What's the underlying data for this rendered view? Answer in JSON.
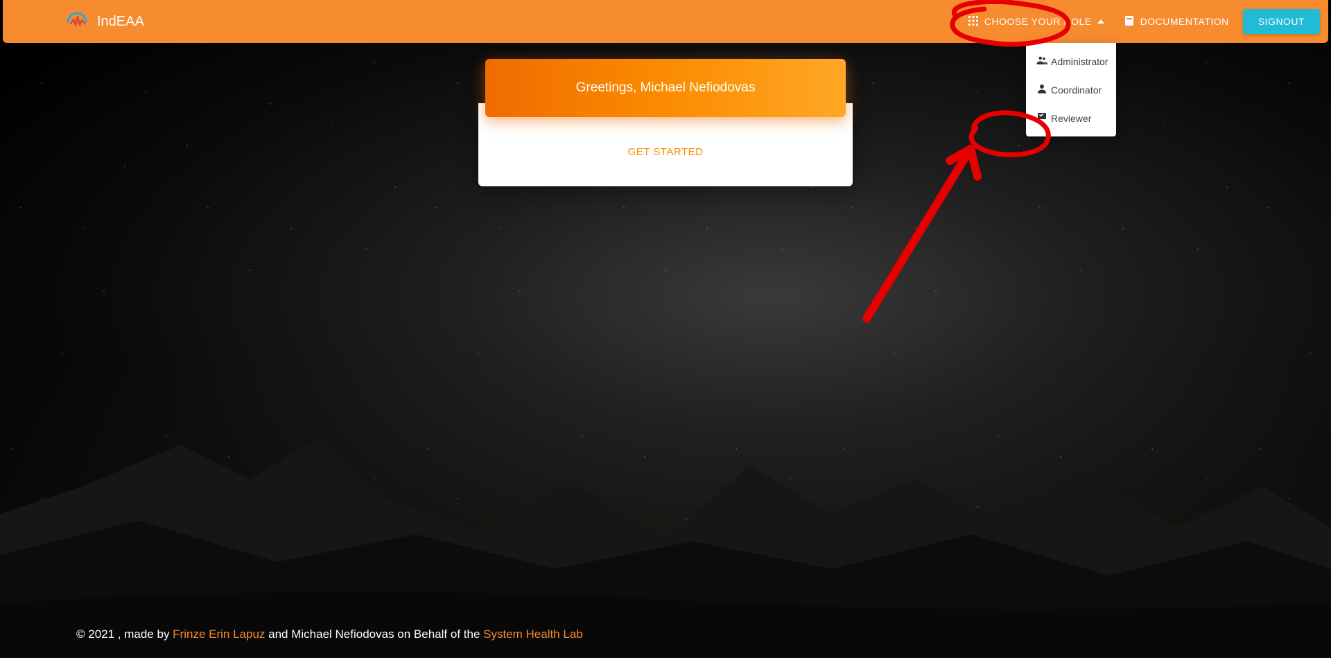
{
  "brand": {
    "title": "IndEAA"
  },
  "nav": {
    "choose_role": "CHOOSE YOUR ROLE",
    "documentation": "DOCUMENTATION",
    "signout": "SIGNOUT"
  },
  "dropdown": {
    "items": [
      {
        "label": "Administrator"
      },
      {
        "label": "Coordinator"
      },
      {
        "label": "Reviewer"
      }
    ]
  },
  "card": {
    "greeting": "Greetings, Michael Nefiodovas",
    "cta": "GET STARTED"
  },
  "footer": {
    "copyright": "© 2021 , made by ",
    "author_link": "Frinze Erin Lapuz",
    "mid": " and Michael Nefiodovas on Behalf of the ",
    "org_link": "System Health Lab"
  },
  "colors": {
    "brand_orange": "#f68b30",
    "accent_cyan": "#22bbd6",
    "annotation_red": "#e60000"
  }
}
